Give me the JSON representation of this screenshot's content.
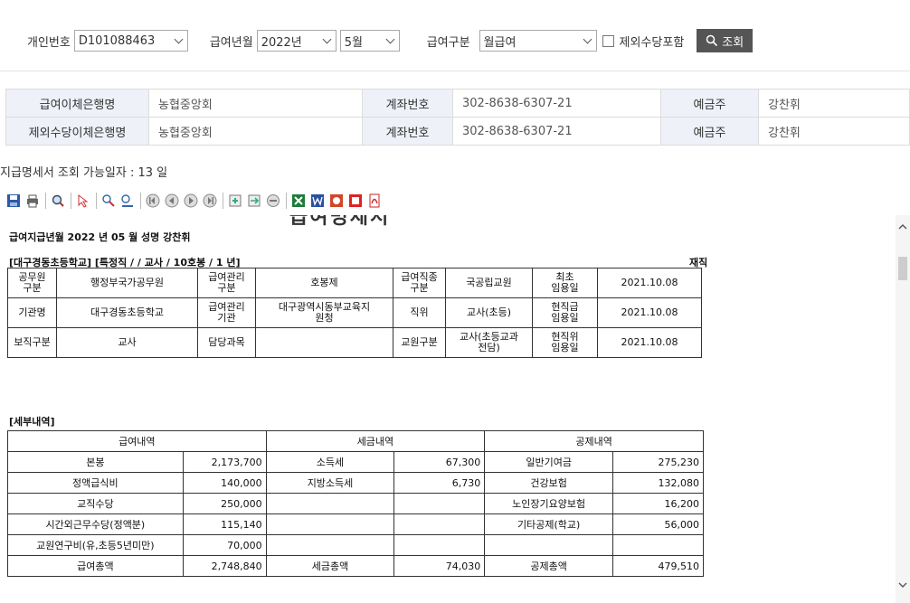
{
  "search": {
    "employee_label": "개인번호",
    "employee_value": "D101088463",
    "paymonth_label": "급여년월",
    "year_value": "2022년",
    "month_value": "5월",
    "paytype_label": "급여구분",
    "paytype_value": "월급여",
    "exclude_label": "제외수당포함",
    "exclude_checked": false,
    "search_button": "조회"
  },
  "bank": {
    "rows": [
      {
        "bank_label": "급여이체은행명",
        "bank_value": "농협중앙회",
        "acct_label": "계좌번호",
        "acct_value": "302-8638-6307-21",
        "holder_label": "예금주",
        "holder_value": "강찬휘"
      },
      {
        "bank_label": "제외수당이체은행명",
        "bank_value": "농협중앙회",
        "acct_label": "계좌번호",
        "acct_value": "302-8638-6307-21",
        "holder_label": "예금주",
        "holder_value": "강찬휘"
      }
    ]
  },
  "days_text": "지급명세서 조회 가능일자 :  13   일",
  "toolbar_icons": [
    "save-icon",
    "print-icon",
    "zoom-icon",
    "cursor-icon",
    "find-icon",
    "find-next-icon",
    "first-page-icon",
    "prev-page-icon",
    "next-page-icon",
    "last-page-icon",
    "page-setup-icon",
    "export-icon",
    "stop-icon",
    "excel-icon",
    "word-icon",
    "ppt-icon",
    "pdf-red-icon",
    "pdf-icon"
  ],
  "report": {
    "title_partial": "급여명세서",
    "period_line": "급여지급년월  2022 년  05 월    성명  강찬휘",
    "school_line": "[대구경동초등학교]   [특정직  /   / 교사  /  10호봉  /  1 년]",
    "status": "재직",
    "info_rows": [
      [
        "공무원\n구분",
        "행정부국가공무원",
        "급여관리\n구분",
        "호봉제",
        "급여직종\n구분",
        "국공립교원",
        "최초\n임용일",
        "2021.10.08"
      ],
      [
        "기관명",
        "대구경동초등학교",
        "급여관리\n기관",
        "대구광역시동부교육지\n원청",
        "직위",
        "교사(초등)",
        "현직급\n임용일",
        "2021.10.08"
      ],
      [
        "보직구분",
        "교사",
        "담당과목",
        "",
        "교원구분",
        "교사(초등교과\n전담)",
        "현직위\n임용일",
        "2021.10.08"
      ]
    ],
    "detail_title": "[세부내역]",
    "detail_headers": [
      "급여내역",
      "세금내역",
      "공제내역"
    ],
    "detail_rows": [
      [
        "본봉",
        "2,173,700",
        "소득세",
        "67,300",
        "일반기여금",
        "275,230"
      ],
      [
        "정액급식비",
        "140,000",
        "지방소득세",
        "6,730",
        "건강보험",
        "132,080"
      ],
      [
        "교직수당",
        "250,000",
        "",
        "",
        "노인장기요양보험",
        "16,200"
      ],
      [
        "시간외근무수당(정액분)",
        "115,140",
        "",
        "",
        "기타공제(학교)",
        "56,000"
      ],
      [
        "교원연구비(유,초등5년미만)",
        "70,000",
        "",
        "",
        "",
        ""
      ],
      [
        "급여총액",
        "2,748,840",
        "세금총액",
        "74,030",
        "공제총액",
        "479,510"
      ]
    ]
  }
}
